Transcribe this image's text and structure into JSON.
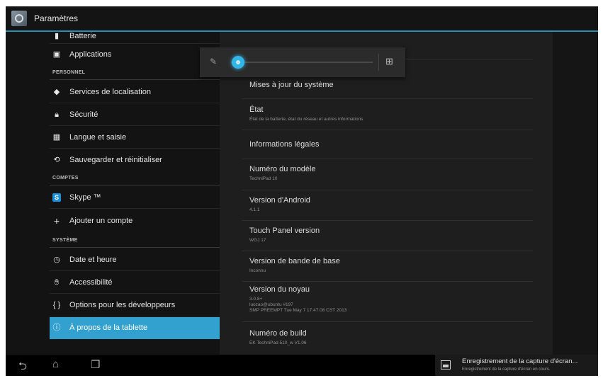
{
  "actionbar": {
    "title": "Paramètres",
    "icon": "settings-app-icon"
  },
  "left_pane": {
    "cut_item": {
      "label": "Batterie",
      "icon": "battery-icon"
    },
    "items_top": [
      {
        "label": "Applications",
        "icon": "apps-icon"
      }
    ],
    "section_personnel": "PERSONNEL",
    "items_personnel": [
      {
        "label": "Services de localisation",
        "icon": "location-icon"
      },
      {
        "label": "Sécurité",
        "icon": "lock-icon"
      },
      {
        "label": "Langue et saisie",
        "icon": "keyboard-icon"
      },
      {
        "label": "Sauvegarder et réinitialiser",
        "icon": "backup-icon"
      }
    ],
    "section_comptes": "COMPTES",
    "items_comptes": [
      {
        "label": "Skype ™",
        "icon": "skype-icon"
      },
      {
        "label": "Ajouter un compte",
        "icon": "plus-icon"
      }
    ],
    "section_systeme": "SYSTÈME",
    "items_systeme": [
      {
        "label": "Date et heure",
        "icon": "clock-icon"
      },
      {
        "label": "Accessibilité",
        "icon": "hand-icon"
      },
      {
        "label": "Options pour les développeurs",
        "icon": "braces-icon"
      },
      {
        "label": "À propos de la tablette",
        "icon": "info-icon",
        "selected": true
      }
    ]
  },
  "right_pane": {
    "items": [
      {
        "title": "Mises à jour du système",
        "subtitle": ""
      },
      {
        "title": "État",
        "subtitle": "État de la batterie, état du réseau et autres informations"
      },
      {
        "title": "Informations légales",
        "subtitle": ""
      },
      {
        "title": "Numéro du modèle",
        "subtitle": "TechniPad 10"
      },
      {
        "title": "Version d'Android",
        "subtitle": "4.1.1"
      },
      {
        "title": "Touch Panel version",
        "subtitle": "WGJ 17"
      },
      {
        "title": "Version de bande de base",
        "subtitle": "Inconnu"
      },
      {
        "title": "Version du noyau",
        "subtitle": "3.0.8+\nluozao@ubuntu #197\nSMP PREEMPT Tue May 7 17:47:08 CST 2013"
      },
      {
        "title": "Numéro de build",
        "subtitle": "EK TechniPad 510_w V1.06"
      }
    ]
  },
  "brightness": {
    "level": 0.05,
    "icon": "brightness-icon",
    "auto_icon": "auto-brightness-icon"
  },
  "navbar": {
    "back_icon": "back-icon",
    "home_icon": "home-icon",
    "recents_icon": "recents-icon",
    "notification_title": "Enregistrement de la capture d'écran...",
    "notification_subtitle": "Enregistrement de la capture d'écran en cours.",
    "notification_icon": "image-icon"
  }
}
